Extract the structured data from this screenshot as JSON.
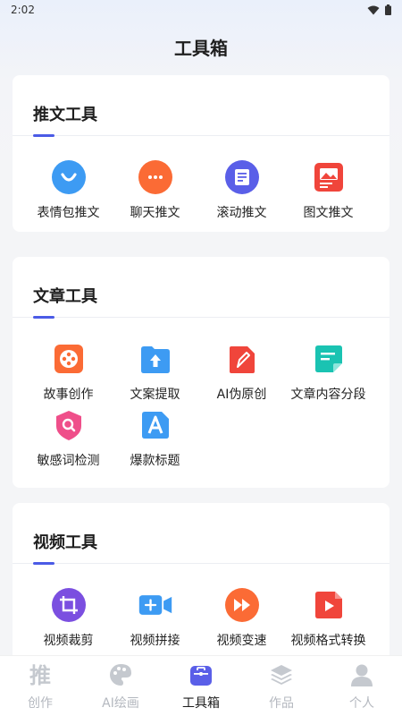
{
  "status_bar": {
    "time": "2:02"
  },
  "page": {
    "title": "工具箱"
  },
  "sections": [
    {
      "title": "推文工具",
      "tools": [
        {
          "label": "表情包推文",
          "icon": "emoji-icon"
        },
        {
          "label": "聊天推文",
          "icon": "chat-icon"
        },
        {
          "label": "滚动推文",
          "icon": "document-icon"
        },
        {
          "label": "图文推文",
          "icon": "image-icon"
        }
      ]
    },
    {
      "title": "文章工具",
      "tools": [
        {
          "label": "故事创作",
          "icon": "film-reel-icon"
        },
        {
          "label": "文案提取",
          "icon": "folder-upload-icon"
        },
        {
          "label": "AI伪原创",
          "icon": "pen-document-icon"
        },
        {
          "label": "文章内容分段",
          "icon": "segment-document-icon"
        },
        {
          "label": "敏感词检测",
          "icon": "shield-search-icon"
        },
        {
          "label": "爆款标题",
          "icon": "letter-a-icon"
        }
      ]
    },
    {
      "title": "视频工具",
      "tools": [
        {
          "label": "视频裁剪",
          "icon": "crop-icon"
        },
        {
          "label": "视频拼接",
          "icon": "video-add-icon"
        },
        {
          "label": "视频变速",
          "icon": "fast-forward-icon"
        },
        {
          "label": "视频格式转换",
          "icon": "play-document-icon"
        }
      ]
    }
  ],
  "tabbar": {
    "items": [
      {
        "label": "创作",
        "icon": "tui-glyph-icon",
        "active": false
      },
      {
        "label": "AI绘画",
        "icon": "palette-icon",
        "active": false
      },
      {
        "label": "工具箱",
        "icon": "toolbox-icon",
        "active": true
      },
      {
        "label": "作品",
        "icon": "layers-icon",
        "active": false
      },
      {
        "label": "个人",
        "icon": "person-icon",
        "active": false
      }
    ]
  }
}
